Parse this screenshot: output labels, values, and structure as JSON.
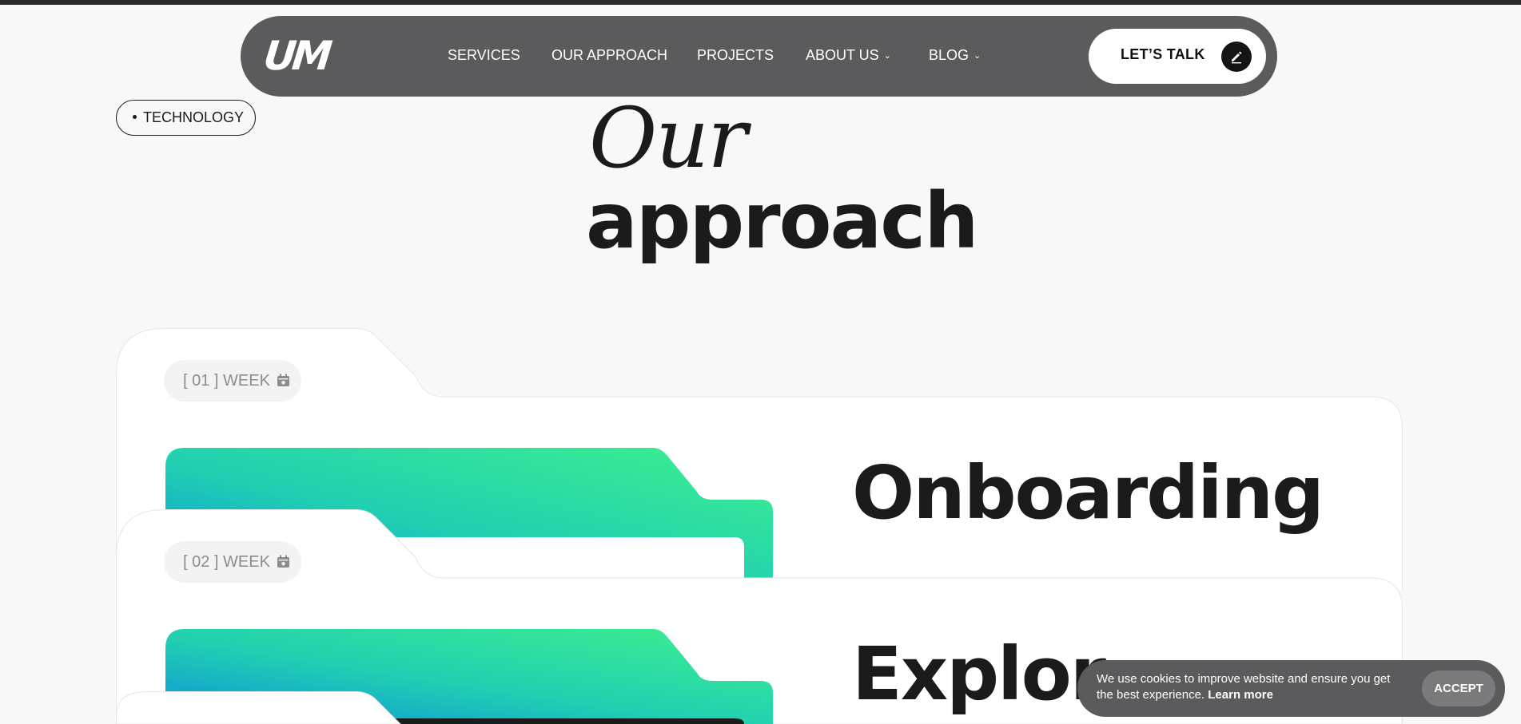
{
  "nav": {
    "logo": "UM",
    "items": [
      {
        "label": "SERVICES",
        "has_dropdown": false
      },
      {
        "label": "OUR APPROACH",
        "has_dropdown": false
      },
      {
        "label": "PROJECTS",
        "has_dropdown": false
      },
      {
        "label": "ABOUT US",
        "has_dropdown": true
      },
      {
        "label": "BLOG",
        "has_dropdown": true
      }
    ],
    "cta_label": "LET’S TALK",
    "cta_icon": "pencil-icon"
  },
  "tag": {
    "label": "TECHNOLOGY"
  },
  "heading": {
    "line1": "Our",
    "line2": "approach"
  },
  "steps": [
    {
      "week_label": "[ 01 ] WEEK",
      "title": "Onboarding"
    },
    {
      "week_label": "[ 02 ] WEEK",
      "title": "Explor"
    }
  ],
  "cookie": {
    "text": "We use cookies to improve website and ensure you get the best experience.",
    "link": "Learn more",
    "accept_label": "ACCEPT"
  },
  "colors": {
    "nav_bg": "#5b5b5d",
    "page_bg": "#f8f8f8",
    "text": "#1b1b1b",
    "gradient_start": "#0a8fd8",
    "gradient_mid": "#21cfb2",
    "gradient_end": "#3ef08c"
  }
}
